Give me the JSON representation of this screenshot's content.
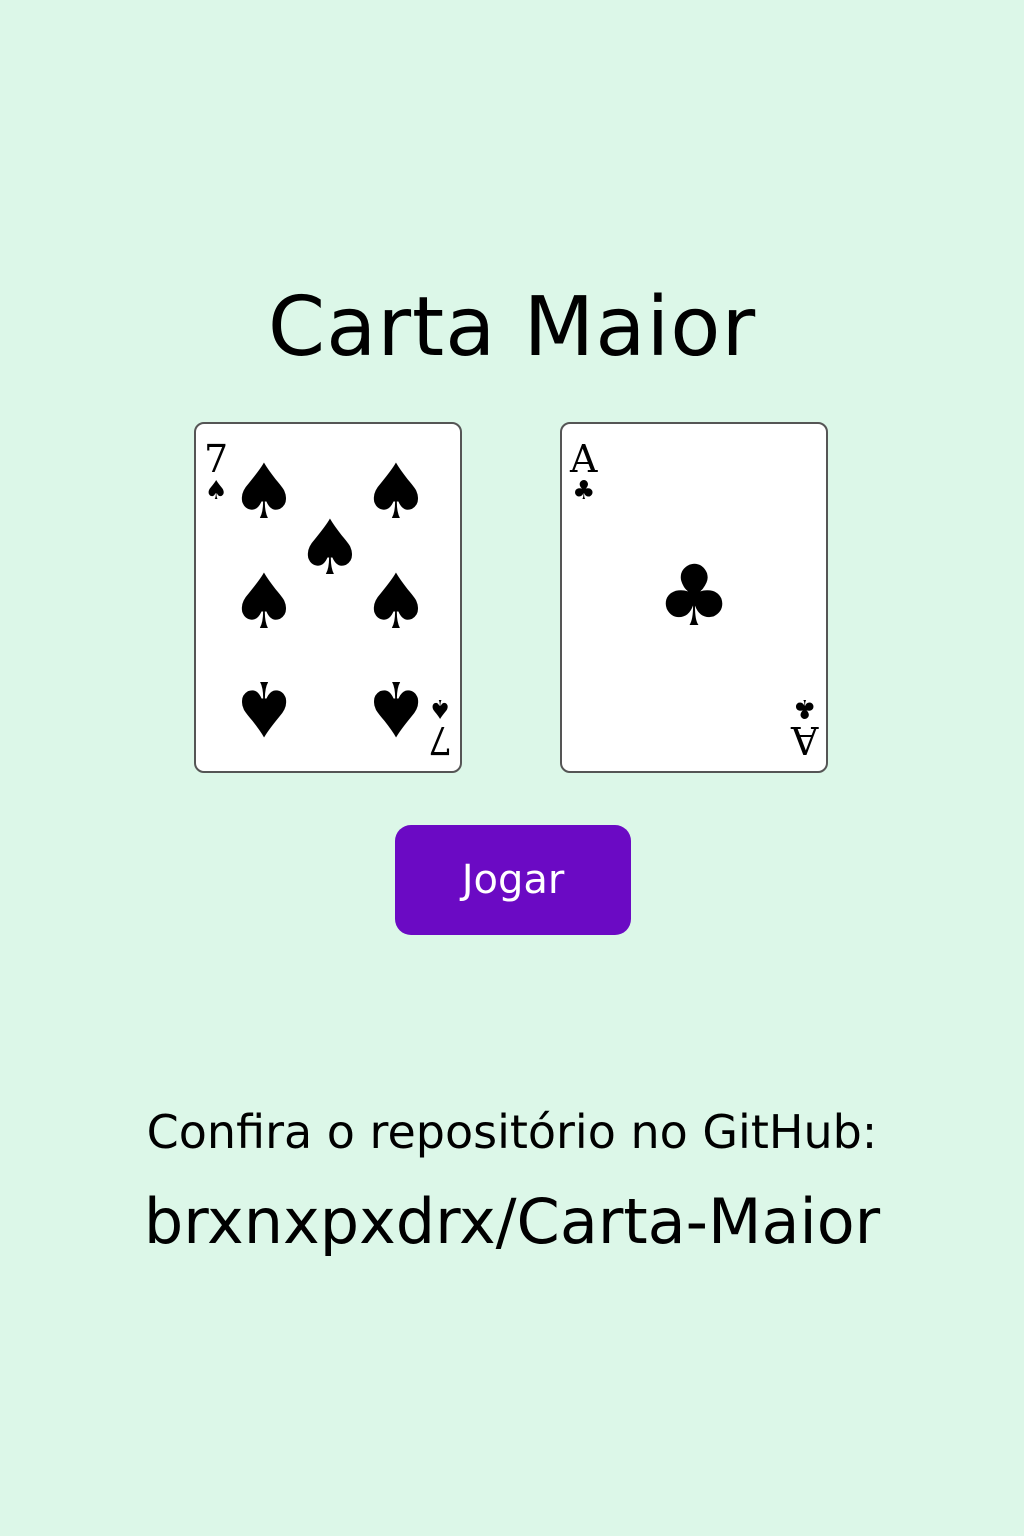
{
  "title": "Carta Maior",
  "cards": [
    {
      "rank": "7",
      "suit": "♠",
      "suit_name": "spades",
      "pip_count": 7
    },
    {
      "rank": "A",
      "suit": "♣",
      "suit_name": "clubs",
      "pip_count": 1
    }
  ],
  "play_button_label": "Jogar",
  "repo_caption": "Confira o repositório no GitHub:",
  "repo_name": "brxnxpxdrx/Carta-Maior",
  "colors": {
    "background": "#dcf7e8",
    "button": "#6b0ac4",
    "button_text": "#ffffff",
    "card_border": "#555555"
  }
}
